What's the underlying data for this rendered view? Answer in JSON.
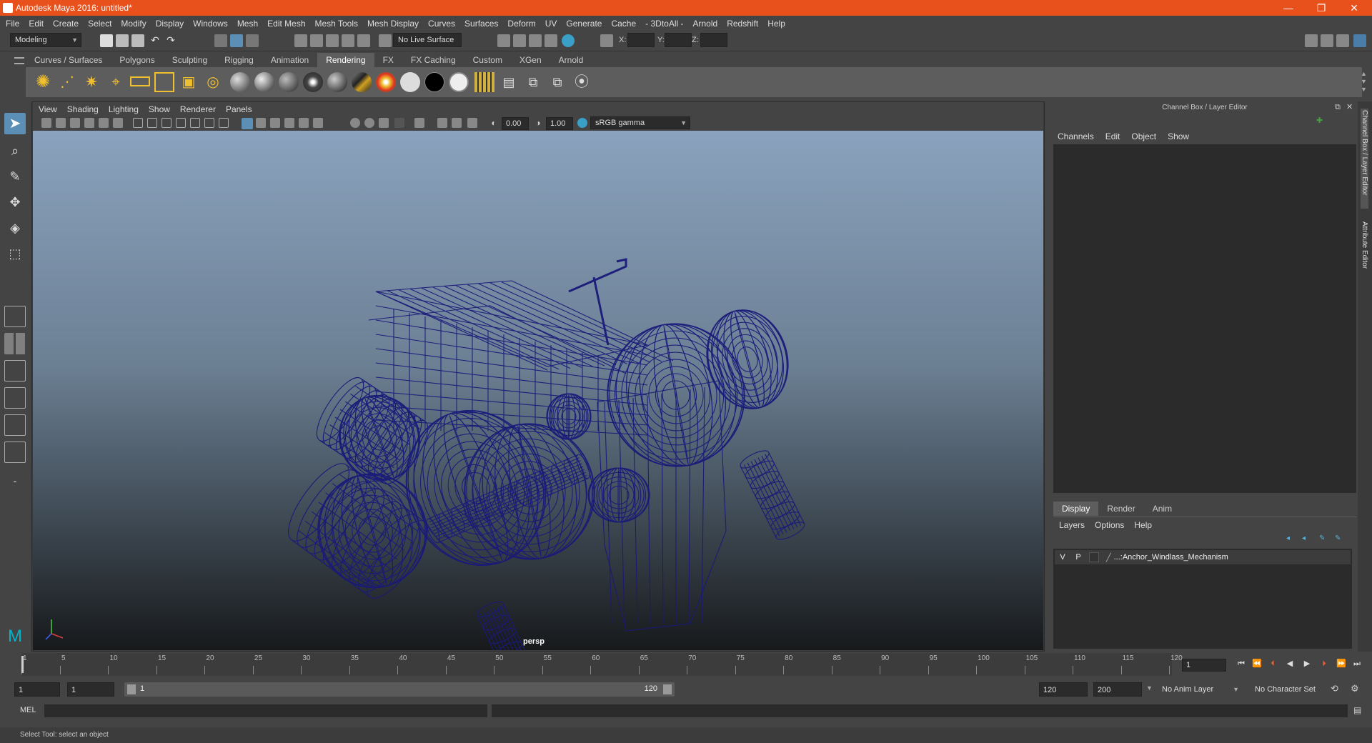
{
  "window": {
    "title": "Autodesk Maya 2016: untitled*"
  },
  "menubar": [
    "File",
    "Edit",
    "Create",
    "Select",
    "Modify",
    "Display",
    "Windows",
    "Mesh",
    "Edit Mesh",
    "Mesh Tools",
    "Mesh Display",
    "Curves",
    "Surfaces",
    "Deform",
    "UV",
    "Generate",
    "Cache",
    "- 3DtoAll -",
    "Arnold",
    "Redshift",
    "Help"
  ],
  "toolbar": {
    "mode": "Modeling",
    "live_surface": "No Live Surface",
    "x_label": "X:",
    "y_label": "Y:",
    "z_label": "Z:"
  },
  "shelf": {
    "tabs": [
      "Curves / Surfaces",
      "Polygons",
      "Sculpting",
      "Rigging",
      "Animation",
      "Rendering",
      "FX",
      "FX Caching",
      "Custom",
      "XGen",
      "Arnold"
    ],
    "active_tab": "Rendering"
  },
  "viewport": {
    "menu": [
      "View",
      "Shading",
      "Lighting",
      "Show",
      "Renderer",
      "Panels"
    ],
    "exposure": "0.00",
    "gamma": "1.00",
    "color_space": "sRGB gamma",
    "camera": "persp",
    "wire_color": "#1a1a7a"
  },
  "channel_box": {
    "title": "Channel Box / Layer Editor",
    "menu": [
      "Channels",
      "Edit",
      "Object",
      "Show"
    ]
  },
  "layer_editor": {
    "tabs": [
      "Display",
      "Render",
      "Anim"
    ],
    "active_tab": "Display",
    "menu": [
      "Layers",
      "Options",
      "Help"
    ],
    "layers": [
      {
        "v": "V",
        "p": "P",
        "name": "...:Anchor_Windlass_Mechanism"
      }
    ]
  },
  "side_tabs": [
    "Channel Box / Layer Editor",
    "Attribute Editor"
  ],
  "timeline": {
    "ticks": [
      "1",
      "5",
      "10",
      "15",
      "20",
      "25",
      "30",
      "35",
      "40",
      "45",
      "50",
      "55",
      "60",
      "65",
      "70",
      "75",
      "80",
      "85",
      "90",
      "95",
      "100",
      "105",
      "110",
      "115",
      "120"
    ],
    "current_frame": "1"
  },
  "range": {
    "start": "1",
    "playback_start": "1",
    "slider_start": "1",
    "slider_end": "120",
    "playback_end": "120",
    "end": "200",
    "anim_layer": "No Anim Layer",
    "character_set": "No Character Set"
  },
  "cmdline": {
    "label": "MEL"
  },
  "status": "Select Tool: select an object"
}
